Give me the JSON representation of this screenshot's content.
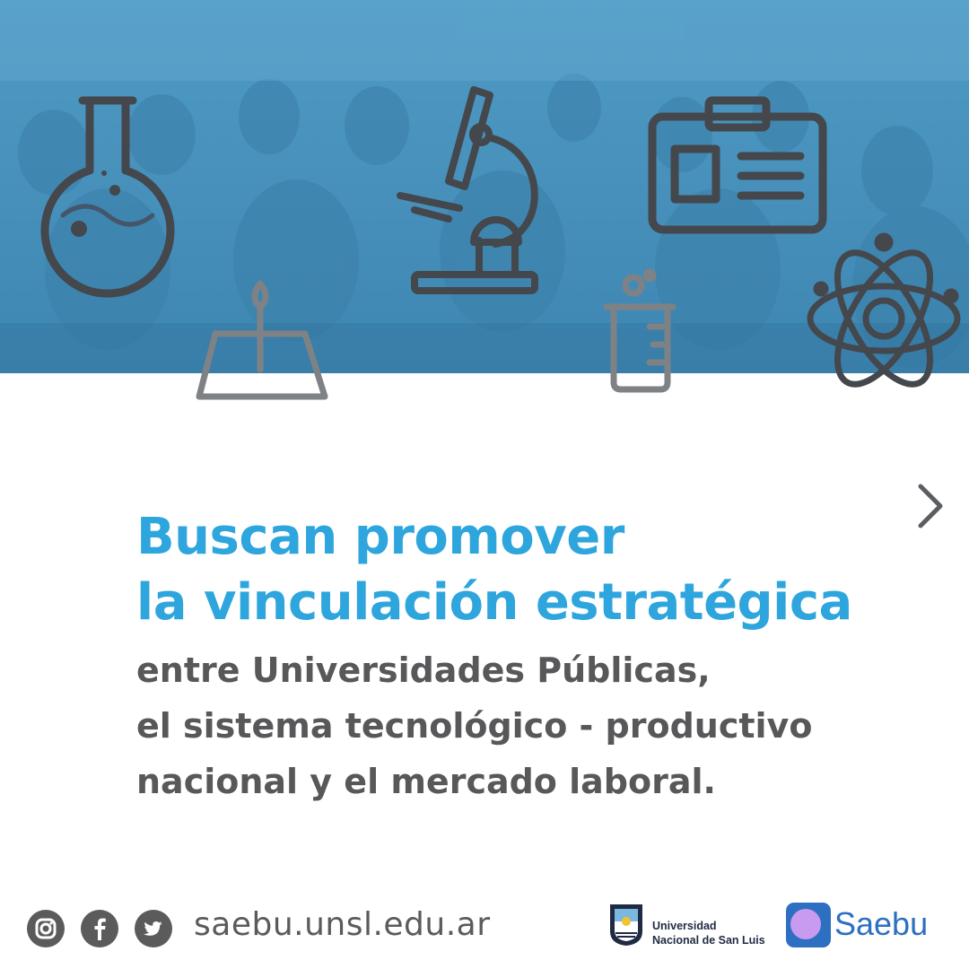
{
  "headline": {
    "line1": "Buscan promover",
    "line2": "la vinculación estratégica"
  },
  "body": {
    "line1": "entre Universidades Públicas,",
    "line2": "el sistema tecnológico - productivo",
    "line3": "nacional y el mercado laboral."
  },
  "footer": {
    "website": "saebu.unsl.edu.ar",
    "social_icons": [
      "instagram-icon",
      "facebook-icon",
      "twitter-icon"
    ],
    "university": {
      "line1": "Universidad",
      "line2": "Nacional de San Luis"
    },
    "saebu_label": "Saebu"
  },
  "colors": {
    "hero_blue": "#4f9bc4",
    "headline_blue": "#2ea6dd",
    "body_gray": "#58585a",
    "icon_gray": "#4a4d52",
    "saebu_blue": "#2d6fc0",
    "saebu_purple": "#c89af0"
  },
  "icons": [
    "flask-icon",
    "microscope-icon",
    "id-card-icon",
    "burner-icon",
    "beaker-icon",
    "atom-icon",
    "chevron-right-icon"
  ]
}
